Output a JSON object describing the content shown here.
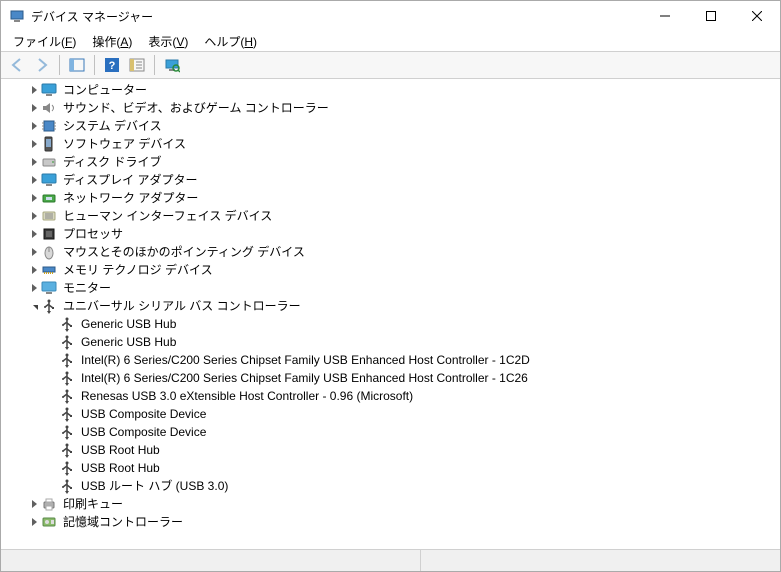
{
  "window": {
    "title": "デバイス マネージャー"
  },
  "menu": {
    "file": {
      "label": "ファイル(",
      "accel": "F",
      "tail": ")"
    },
    "action": {
      "label": "操作(",
      "accel": "A",
      "tail": ")"
    },
    "view": {
      "label": "表示(",
      "accel": "V",
      "tail": ")"
    },
    "help": {
      "label": "ヘルプ(",
      "accel": "H",
      "tail": ")"
    }
  },
  "toolbar": {
    "back": "back",
    "forward": "forward",
    "show_hide": "show-hide-tree",
    "help": "help",
    "properties": "properties",
    "monitor": "scan-hardware"
  },
  "tree": [
    {
      "depth": 1,
      "exp": "closed",
      "icon": "monitor",
      "label": "コンピューター"
    },
    {
      "depth": 1,
      "exp": "closed",
      "icon": "speaker",
      "label": "サウンド、ビデオ、およびゲーム コントローラー"
    },
    {
      "depth": 1,
      "exp": "closed",
      "icon": "chip",
      "label": "システム デバイス"
    },
    {
      "depth": 1,
      "exp": "closed",
      "icon": "soft",
      "label": "ソフトウェア デバイス"
    },
    {
      "depth": 1,
      "exp": "closed",
      "icon": "disk",
      "label": "ディスク ドライブ"
    },
    {
      "depth": 1,
      "exp": "closed",
      "icon": "monitor",
      "label": "ディスプレイ アダプター"
    },
    {
      "depth": 1,
      "exp": "closed",
      "icon": "network",
      "label": "ネットワーク アダプター"
    },
    {
      "depth": 1,
      "exp": "closed",
      "icon": "hid",
      "label": "ヒューマン インターフェイス デバイス"
    },
    {
      "depth": 1,
      "exp": "closed",
      "icon": "cpu",
      "label": "プロセッサ"
    },
    {
      "depth": 1,
      "exp": "closed",
      "icon": "mouse",
      "label": "マウスとそのほかのポインティング デバイス"
    },
    {
      "depth": 1,
      "exp": "closed",
      "icon": "memory",
      "label": "メモリ テクノロジ デバイス"
    },
    {
      "depth": 1,
      "exp": "closed",
      "icon": "monitor2",
      "label": "モニター"
    },
    {
      "depth": 1,
      "exp": "open",
      "icon": "usb",
      "label": "ユニバーサル シリアル バス コントローラー"
    },
    {
      "depth": 2,
      "exp": "none",
      "icon": "usb",
      "label": "Generic USB Hub"
    },
    {
      "depth": 2,
      "exp": "none",
      "icon": "usb",
      "label": "Generic USB Hub"
    },
    {
      "depth": 2,
      "exp": "none",
      "icon": "usb",
      "label": "Intel(R) 6 Series/C200 Series Chipset Family USB Enhanced Host Controller - 1C2D"
    },
    {
      "depth": 2,
      "exp": "none",
      "icon": "usb",
      "label": "Intel(R) 6 Series/C200 Series Chipset Family USB Enhanced Host Controller - 1C26"
    },
    {
      "depth": 2,
      "exp": "none",
      "icon": "usb",
      "label": "Renesas USB 3.0 eXtensible Host Controller - 0.96 (Microsoft)"
    },
    {
      "depth": 2,
      "exp": "none",
      "icon": "usb",
      "label": "USB Composite Device"
    },
    {
      "depth": 2,
      "exp": "none",
      "icon": "usb",
      "label": "USB Composite Device"
    },
    {
      "depth": 2,
      "exp": "none",
      "icon": "usb",
      "label": "USB Root Hub"
    },
    {
      "depth": 2,
      "exp": "none",
      "icon": "usb",
      "label": "USB Root Hub"
    },
    {
      "depth": 2,
      "exp": "none",
      "icon": "usb",
      "label": "USB ルート ハブ (USB 3.0)"
    },
    {
      "depth": 1,
      "exp": "closed",
      "icon": "printer",
      "label": "印刷キュー"
    },
    {
      "depth": 1,
      "exp": "closed",
      "icon": "storage",
      "label": "記憶域コントローラー"
    }
  ]
}
